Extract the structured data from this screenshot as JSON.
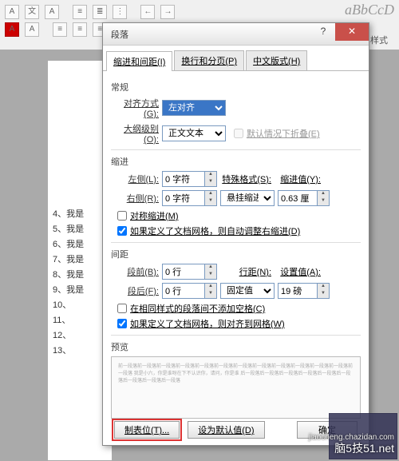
{
  "ribbon": {
    "styles_sample": "aBbCcD",
    "style_label": "样式"
  },
  "doc_lines": [
    "4、我是",
    "5、我是",
    "6、我是",
    "7、我是",
    "8、我是",
    "9、我是",
    "10、",
    "11、",
    "12、",
    "13、"
  ],
  "dialog": {
    "title": "段落",
    "tabs": [
      "缩进和间距(I)",
      "换行和分页(P)",
      "中文版式(H)"
    ],
    "active_tab": 0,
    "section_general": "常规",
    "align_label": "对齐方式(G):",
    "align_value": "左对齐",
    "outline_label": "大纲级别(O):",
    "outline_value": "正文文本",
    "collapse_label": "默认情况下折叠(E)",
    "collapse_checked": false,
    "section_indent": "缩进",
    "left_label": "左侧(L):",
    "left_value": "0 字符",
    "right_label": "右侧(R):",
    "right_value": "0 字符",
    "special_label": "特殊格式(S):",
    "special_value": "悬挂缩进",
    "indent_by_label": "缩进值(Y):",
    "indent_by_value": "0.63 厘",
    "mirror_label": "对称缩进(M)",
    "mirror_checked": false,
    "grid1_label": "如果定义了文档网格，则自动调整右缩进(D)",
    "grid1_checked": true,
    "section_spacing": "间距",
    "before_label": "段前(B):",
    "before_value": "0 行",
    "after_label": "段后(F):",
    "after_value": "0 行",
    "line_label": "行距(N):",
    "line_value": "固定值",
    "at_label": "设置值(A):",
    "at_value": "19 磅",
    "same_style_label": "在相同样式的段落间不添加空格(C)",
    "same_style_checked": false,
    "grid2_label": "如果定义了文档网格，则对齐到网格(W)",
    "grid2_checked": true,
    "section_preview": "预览",
    "preview_text": "前一段落前一段落前一段落前一段落前一段落前一段落前一段落前一段落前一段落前一段落前一段落前一段落前一段落 我是小六，你是谁呀在下不认识你，请问，你是谁 后一段落后一段落后一段落后一段落后一段落后一段落后一段落后一段落后一段落",
    "btn_tabs": "制表位(T)...",
    "btn_default": "设为默认值(D)",
    "btn_ok": "确定"
  },
  "watermark": {
    "line1": "脑5技51.net",
    "line2": "jiaocheng.chazidan.com"
  }
}
